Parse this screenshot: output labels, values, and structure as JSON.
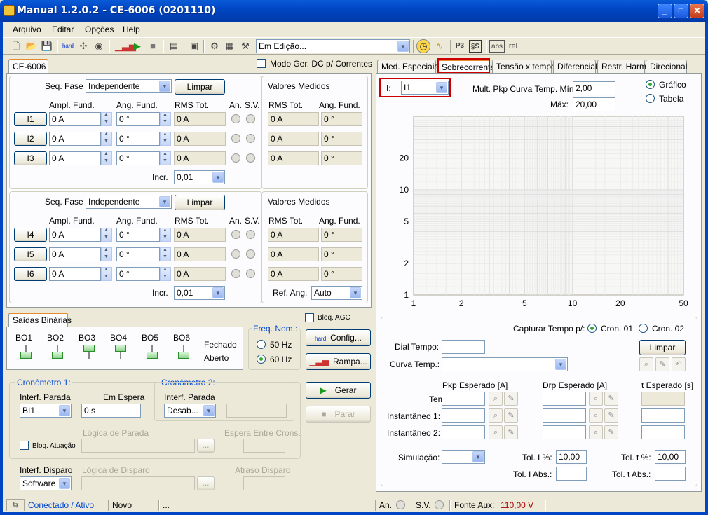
{
  "window": {
    "title": "Manual 1.2.0.2 - CE-6006 (0201110)"
  },
  "menu": [
    "Arquivo",
    "Editar",
    "Opções",
    "Help"
  ],
  "toolbar": {
    "status_select": "Em Edição...",
    "abs": "abs",
    "rel": "rel"
  },
  "left_tab": "CE-6006",
  "modo_ger": "Modo Ger. DC p/ Correntes",
  "seq_fase_label": "Seq. Fase",
  "seq_fase_value": "Independente",
  "limpar": "Limpar",
  "valores_medidos": "Valores Medidos",
  "cols": {
    "ampl": "Ampl. Fund.",
    "ang": "Ang. Fund.",
    "rms": "RMS Tot.",
    "an": "An.",
    "sv": "S.V."
  },
  "incr_label": "Incr.",
  "incr_value": "0,01",
  "ref_ang_label": "Ref. Ang.",
  "ref_ang_value": "Auto",
  "group1": [
    {
      "name": "I1",
      "ampl": "0 A",
      "ang": "0 °",
      "rms": "0 A",
      "mrms": "0 A",
      "mang": "0 °"
    },
    {
      "name": "I2",
      "ampl": "0 A",
      "ang": "0 °",
      "rms": "0 A",
      "mrms": "0 A",
      "mang": "0 °"
    },
    {
      "name": "I3",
      "ampl": "0 A",
      "ang": "0 °",
      "rms": "0 A",
      "mrms": "0 A",
      "mang": "0 °"
    }
  ],
  "group2": [
    {
      "name": "I4",
      "ampl": "0 A",
      "ang": "0 °",
      "rms": "0 A",
      "mrms": "0 A",
      "mang": "0 °"
    },
    {
      "name": "I5",
      "ampl": "0 A",
      "ang": "0 °",
      "rms": "0 A",
      "mrms": "0 A",
      "mang": "0 °"
    },
    {
      "name": "I6",
      "ampl": "0 A",
      "ang": "0 °",
      "rms": "0 A",
      "mrms": "0 A",
      "mang": "0 °"
    }
  ],
  "saidas": {
    "tab": "Saídas Binárias",
    "outputs": [
      "BO1",
      "BO2",
      "BO3",
      "BO4",
      "BO5",
      "BO6"
    ],
    "fechado": "Fechado",
    "aberto": "Aberto"
  },
  "freq": {
    "label": "Freq. Nom.:",
    "opt50": "50 Hz",
    "opt60": "60 Hz"
  },
  "bloq_agc": "Bloq. AGC",
  "config": "Config...",
  "rampa": "Rampa...",
  "gerar": "Gerar",
  "parar": "Parar",
  "cron1": {
    "title": "Cronômetro 1:",
    "interf": "Interf. Parada",
    "interf_value": "BI1",
    "espera": "Em Espera",
    "espera_value": "0 s",
    "logica": "Lógica de Parada",
    "bloq": "Bloq. Atuação"
  },
  "cron2": {
    "title": "Cronômetro 2:",
    "interf": "Interf. Parada",
    "interf_value": "Desab...",
    "espera_entre": "Espera Entre Crons."
  },
  "disparo": {
    "interf": "Interf. Disparo",
    "interf_value": "Software",
    "logica": "Lógica de Disparo",
    "atraso": "Atraso Disparo",
    "dots": "..."
  },
  "right_tabs": [
    "Med. Especiais",
    "Sobrecorrente",
    "Tensão x tempo",
    "Diferencial",
    "Restr. Harm.",
    "Direcional"
  ],
  "sobre": {
    "i_label": "I:",
    "i_value": "I1",
    "mult_min_label": "Mult. Pkp Curva Temp. Mín:",
    "mult_min": "2,00",
    "max_label": "Máx:",
    "max": "20,00",
    "grafico": "Gráfico",
    "tabela": "Tabela"
  },
  "chart_data": {
    "type": "line",
    "title": "",
    "xlabel": "",
    "ylabel": "",
    "x_scale": "log",
    "y_scale": "log",
    "xlim": [
      1,
      50
    ],
    "ylim": [
      1,
      50
    ],
    "x_ticks": [
      "1",
      "2",
      "5",
      "10",
      "20",
      "50"
    ],
    "y_ticks": [
      "1",
      "2",
      "5",
      "10",
      "20"
    ],
    "series": [],
    "grid": true
  },
  "capture": {
    "label": "Capturar Tempo p/:",
    "cron01": "Cron. 01",
    "cron02": "Cron. 02",
    "dial": "Dial Tempo:",
    "curva": "Curva Temp.:",
    "limpar": "Limpar"
  },
  "esperado": {
    "pkp": "Pkp Esperado [A]",
    "drp": "Drp Esperado [A]",
    "t": "t Esperado [s]",
    "rows": [
      "Temp. :",
      "Instantâneo 1:",
      "Instantâneo 2:"
    ]
  },
  "sim": {
    "label": "Simulação:",
    "toli_pct": "Tol. I %:",
    "toli_pct_v": "10,00",
    "tolt_pct": "Tol. t %:",
    "tolt_pct_v": "10,00",
    "toli_abs": "Tol. I Abs.:",
    "tolt_abs": "Tol. t Abs.:"
  },
  "status": {
    "conn": "Conectado / Ativo",
    "novo": "Novo",
    "dots": "...",
    "an": "An.",
    "sv": "S.V.",
    "fonte_label": "Fonte Aux:",
    "fonte_value": "110,00 V"
  },
  "colors": {
    "accent": "#0046c4",
    "red": "#cc0000"
  }
}
